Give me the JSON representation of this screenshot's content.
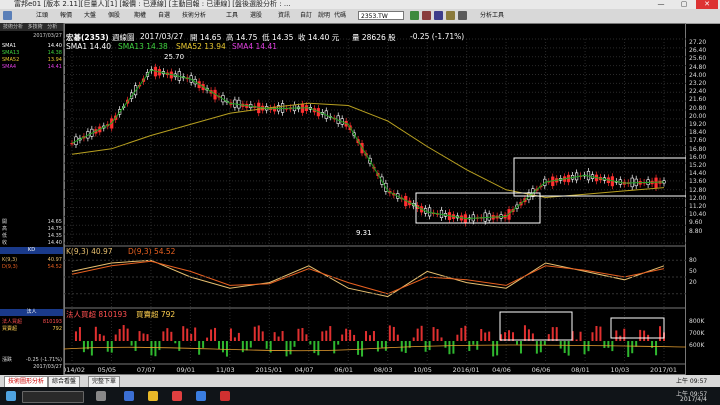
{
  "window": {
    "title": "富邦e01 [版本 2.11][巨量人][1] [報價 : 已連線] [主動回報 : 已連線] [盤後選股分析 : ..."
  },
  "toolbar": {
    "items": [
      "江頭",
      "報價",
      "大盤",
      "個股",
      "期權",
      "自選",
      "技術分析",
      "工具",
      "選股",
      "",
      "資訊",
      "自訂",
      "說明"
    ],
    "code_label": "代碼",
    "code_value": "2353.TW",
    "analysis_label": "分析工具"
  },
  "left_panel": {
    "tabs": [
      "技術分析",
      "多技術",
      "分析"
    ],
    "date": "2017/03/27",
    "rows_top": [
      {
        "k": "SMA1",
        "v": "14.40"
      },
      {
        "k": "SMA13",
        "v": "14.38"
      },
      {
        "k": "SMA52",
        "v": "13.94"
      },
      {
        "k": "SMA4",
        "v": "14.41"
      }
    ],
    "rows_ohlc": [
      {
        "k": "開",
        "v": "14.65"
      },
      {
        "k": "高",
        "v": "14.75"
      },
      {
        "k": "低",
        "v": "14.35"
      },
      {
        "k": "收",
        "v": "14.40"
      }
    ],
    "kd_title": "KD",
    "kd_rows": [
      {
        "k": "K(9,3)",
        "v": "40.97"
      },
      {
        "k": "D(9,3)",
        "v": "54.52"
      }
    ],
    "vol_title": "法人",
    "vol_rows": [
      {
        "k": "法人買超",
        "v": "810193"
      },
      {
        "k": "買賣超",
        "v": "792"
      }
    ],
    "bottom_rows": [
      {
        "k": "漲跌",
        "v": "-0.25 (-1.71%)"
      },
      {
        "k": "",
        "v": "2017/03/27"
      }
    ]
  },
  "header": {
    "stock": "宏碁(2353)",
    "period": "週線圖",
    "date": "2017/03/27",
    "open": "開 14.65",
    "high": "高 14.75",
    "low": "低 14.35",
    "close": "收 14.40 元",
    "volume": "量 28626 股",
    "change": "-0.25 (-1.71%)",
    "sma1": "SMA1 14.40",
    "sma13": "SMA13 14.38",
    "sma52": "SMA52 13.94",
    "sma4": "SMA4 14.41",
    "kd_k": "K(9,3) 40.97",
    "kd_d": "D(9,3) 54.52",
    "vol_label": "法人買超 810193",
    "vol_label2": "買賣超 792"
  },
  "price_ticks": [
    "27.20",
    "26.40",
    "25.60",
    "24.80",
    "24.00",
    "23.20",
    "22.40",
    "21.60",
    "20.80",
    "20.00",
    "19.20",
    "18.40",
    "17.60",
    "16.80",
    "16.00",
    "15.20",
    "14.40",
    "13.60",
    "12.80",
    "12.00",
    "11.20",
    "10.40",
    "9.60",
    "8.80"
  ],
  "kd_ticks": [
    "80",
    "50",
    "20"
  ],
  "vol_ticks": [
    "800K",
    "700K",
    "600K"
  ],
  "date_ticks": [
    "2014/02",
    "05/05",
    "07/07",
    "09/01",
    "11/03",
    "2015/01",
    "04/07",
    "06/01",
    "08/03",
    "10/05",
    "2016/01",
    "04/06",
    "06/06",
    "08/01",
    "10/03",
    "2017/01"
  ],
  "annotations": {
    "high": "25.70",
    "low": "9.31"
  },
  "bottom_tabs": [
    "技術圖形分析",
    "綜合看盤",
    "完整下單"
  ],
  "status": {
    "time": "上午 09:57",
    "date": "2017/4/4"
  },
  "colors": {
    "up": "#ff3030",
    "down": "#ffffff",
    "sma13": "#1fa51f",
    "sma52": "#b8a020",
    "k": "#e8c070",
    "d": "#e86020"
  },
  "chart_data": {
    "type": "line",
    "x": [
      "2014/02",
      "05/05",
      "07/07",
      "09/01",
      "11/03",
      "2015/01",
      "04/07",
      "06/01",
      "08/03",
      "10/05",
      "2016/01",
      "04/06",
      "06/06",
      "08/01",
      "10/03",
      "2017/01"
    ],
    "series": [
      {
        "name": "SMA13",
        "values": [
          17.8,
          19.6,
          24.4,
          23.6,
          21.4,
          20.9,
          21.0,
          19.5,
          13.5,
          11.6,
          11.0,
          11.2,
          14.3,
          14.9,
          14.2,
          14.3
        ]
      },
      {
        "name": "SMA52",
        "values": [
          16.8,
          17.3,
          18.5,
          19.5,
          20.5,
          21.0,
          21.4,
          21.2,
          19.8,
          17.5,
          15.4,
          13.6,
          12.9,
          13.2,
          13.5,
          13.8
        ]
      },
      {
        "name": "K(9,3)",
        "values": [
          60,
          75,
          80,
          50,
          30,
          40,
          70,
          30,
          15,
          60,
          40,
          30,
          75,
          60,
          45,
          70
        ]
      },
      {
        "name": "D(9,3)",
        "values": [
          55,
          70,
          78,
          60,
          35,
          38,
          65,
          40,
          20,
          50,
          45,
          35,
          70,
          62,
          50,
          65
        ]
      }
    ],
    "ylim": [
      8.8,
      27.2
    ]
  }
}
